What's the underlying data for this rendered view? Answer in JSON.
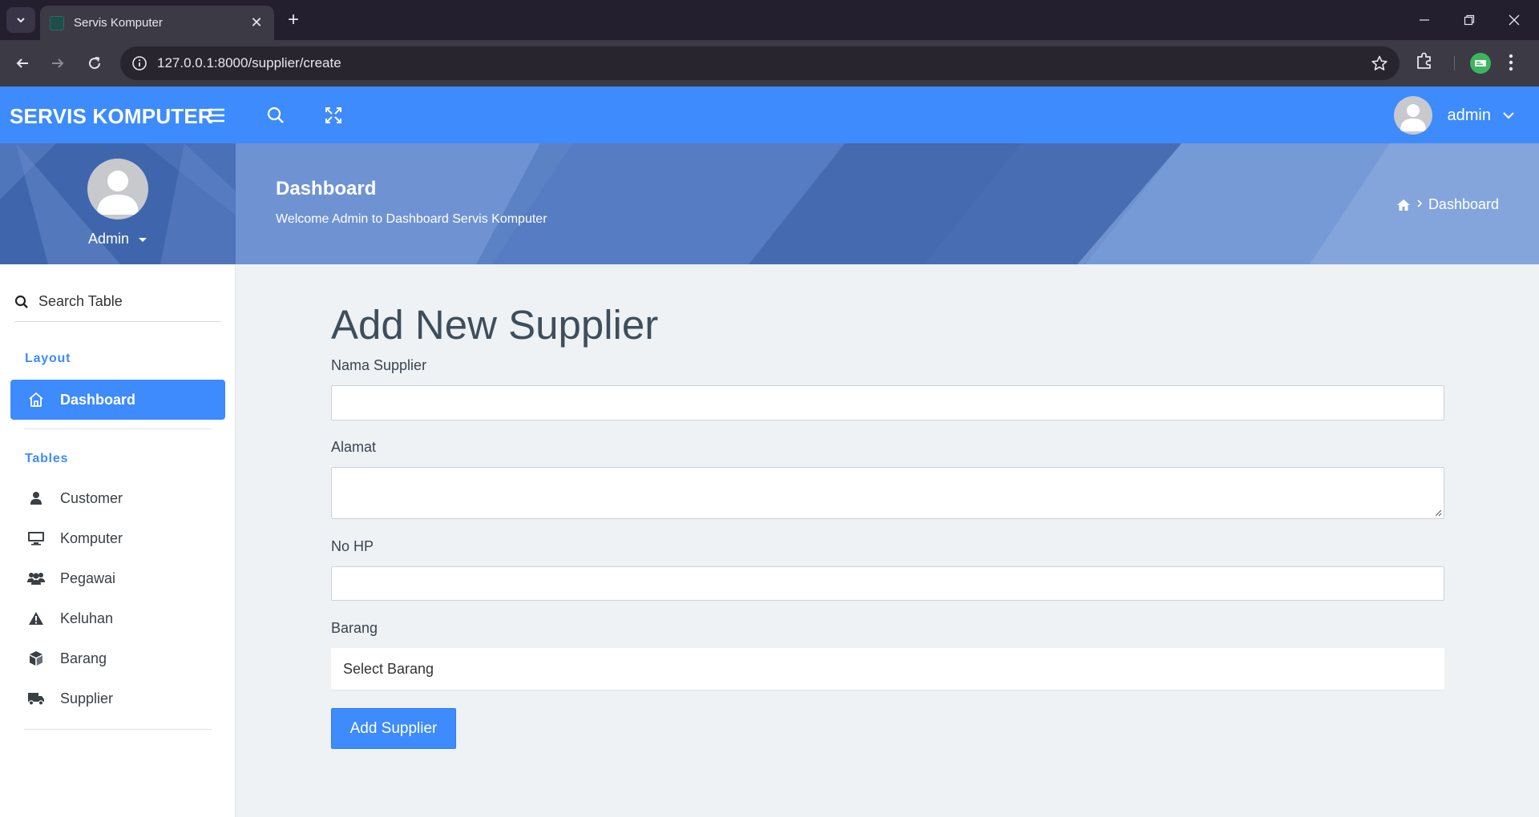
{
  "browser": {
    "tab_title": "Servis Komputer",
    "url": "127.0.0.1:8000/supplier/create"
  },
  "header": {
    "brand": "SERVIS KOMPUTER",
    "user_name": "admin",
    "accent_color": "#3d8bfd"
  },
  "profile": {
    "name": "Admin"
  },
  "banner": {
    "title": "Dashboard",
    "subtitle": "Welcome Admin to Dashboard Servis Komputer",
    "breadcrumb": "Dashboard"
  },
  "sidebar": {
    "search_label": "Search Table",
    "section_layout": "Layout",
    "section_tables": "Tables",
    "items": [
      {
        "label": "Dashboard",
        "icon": "home-icon"
      },
      {
        "label": "Customer",
        "icon": "user-icon"
      },
      {
        "label": "Komputer",
        "icon": "desktop-icon"
      },
      {
        "label": "Pegawai",
        "icon": "users-icon"
      },
      {
        "label": "Keluhan",
        "icon": "warning-icon"
      },
      {
        "label": "Barang",
        "icon": "box-icon"
      },
      {
        "label": "Supplier",
        "icon": "truck-icon"
      }
    ]
  },
  "form": {
    "title": "Add New Supplier",
    "nama_label": "Nama Supplier",
    "nama_value": "",
    "alamat_label": "Alamat",
    "alamat_value": "",
    "hp_label": "No HP",
    "hp_value": "",
    "barang_label": "Barang",
    "barang_selected": "Select Barang",
    "submit_label": "Add Supplier"
  }
}
